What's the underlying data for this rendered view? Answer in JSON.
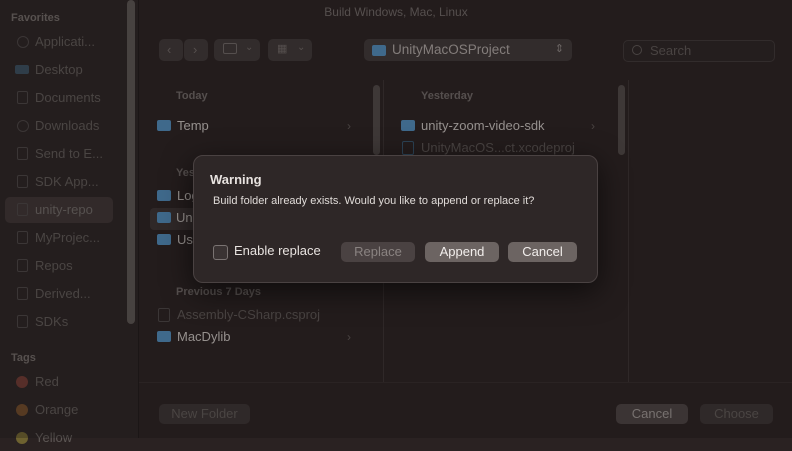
{
  "window": {
    "title": "Build Windows, Mac, Linux"
  },
  "sidebar": {
    "favorites_heading": "Favorites",
    "favorites": [
      {
        "label": "Applicati...",
        "icon": "applications-icon"
      },
      {
        "label": "Desktop",
        "icon": "desktop-icon"
      },
      {
        "label": "Documents",
        "icon": "document-icon"
      },
      {
        "label": "Downloads",
        "icon": "download-icon"
      },
      {
        "label": "Send to E...",
        "icon": "document-icon"
      },
      {
        "label": "SDK App...",
        "icon": "document-icon"
      },
      {
        "label": "unity-repo",
        "icon": "folder-icon",
        "selected": true
      },
      {
        "label": "MyProjec...",
        "icon": "document-icon"
      },
      {
        "label": "Repos",
        "icon": "document-icon"
      },
      {
        "label": "Derived...",
        "icon": "document-icon"
      },
      {
        "label": "SDKs",
        "icon": "document-icon"
      }
    ],
    "tags_heading": "Tags",
    "tags": [
      {
        "label": "Red",
        "color": "#c0392b"
      },
      {
        "label": "Orange",
        "color": "#d67a1f"
      },
      {
        "label": "Yellow",
        "color": "#d9b92a"
      }
    ]
  },
  "toolbar": {
    "path_popup": "UnityMacOSProject",
    "search_placeholder": "Search"
  },
  "columns": {
    "col1": {
      "today_heading": "Today",
      "today_items": [
        {
          "label": "Temp"
        }
      ],
      "yesterday_partial": "Yes",
      "partial_items": [
        "Log",
        "Un",
        "Us"
      ],
      "prev7_heading": "Previous 7 Days",
      "prev7_items": [
        {
          "label": "Assembly-CSharp.csproj",
          "dim": true
        },
        {
          "label": "MacDylib"
        }
      ]
    },
    "col2": {
      "yesterday_heading": "Yesterday",
      "items": [
        {
          "label": "unity-zoom-video-sdk"
        },
        {
          "label": "UnityMacOS...ct.xcodeproj",
          "dim": true
        }
      ]
    }
  },
  "bottom_bar": {
    "new_folder": "New Folder",
    "cancel": "Cancel",
    "choose": "Choose"
  },
  "dialog": {
    "title": "Warning",
    "message": "Build folder already exists. Would you like to append or replace it?",
    "checkbox_label": "Enable replace",
    "checkbox_checked": false,
    "replace_label": "Replace",
    "append_label": "Append",
    "cancel_label": "Cancel"
  }
}
